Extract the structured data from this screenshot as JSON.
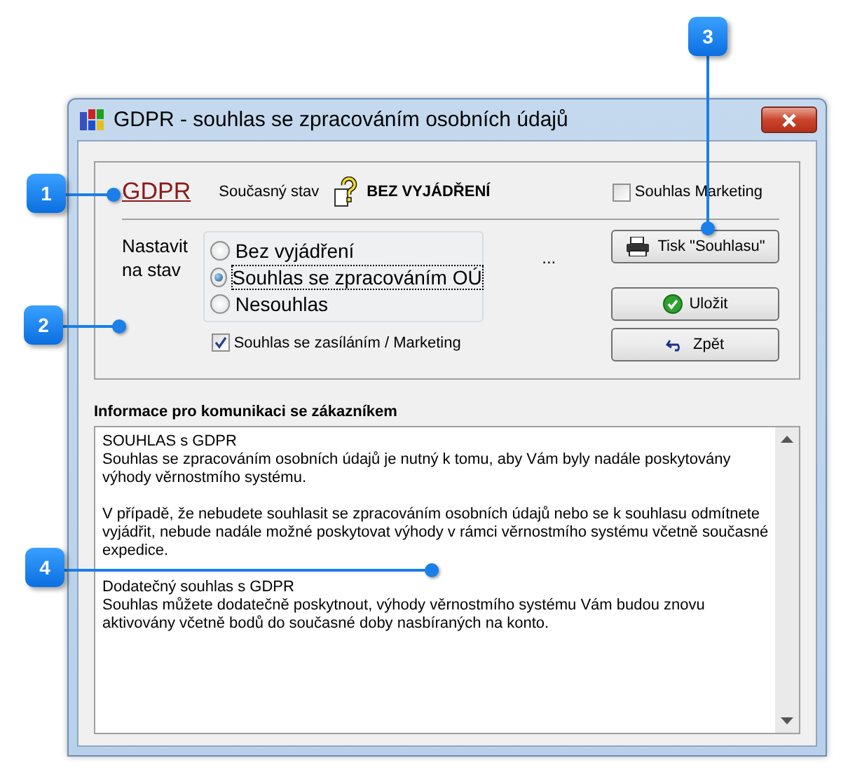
{
  "window": {
    "title": "GDPR - souhlas se zpracováním osobních údajů"
  },
  "header": {
    "link": "GDPR",
    "status_label": "Současný stav",
    "status_value": "BEZ VYJÁDŘENÍ",
    "marketing": {
      "label": "Souhlas Marketing",
      "checked": false
    }
  },
  "set_state": {
    "label": "Nastavit na stav",
    "options": [
      {
        "label": "Bez vyjádření",
        "selected": false
      },
      {
        "label": "Souhlas se zpracováním OÚ",
        "selected": true
      },
      {
        "label": "Nesouhlas",
        "selected": false
      }
    ],
    "mailing": {
      "label": "Souhlas se zasíláním  / Marketing",
      "checked": true
    },
    "ellipsis": "..."
  },
  "buttons": [
    {
      "kind": "print",
      "label": "Tisk \"Souhlasu\""
    },
    {
      "kind": "save",
      "label": "Uložit"
    },
    {
      "kind": "back",
      "label": "Zpět"
    }
  ],
  "info": {
    "label": "Informace pro komunikaci se zákazníkem",
    "blocks": [
      {
        "heading": "SOUHLAS s GDPR",
        "text": "Souhlas se zpracováním osobních údajů je nutný k tomu, aby Vám byly nadále poskytovány výhody věrnostmího systému."
      },
      {
        "text": "V případě, že nebudete souhlasit se zpracováním osobních údajů nebo se k souhlasu odmítnete vyjádřit, nebude nadále možné poskytovat výhody v rámci  věrnostmího systému včetně současné expedice."
      },
      {
        "heading": "Dodatečný souhlas s GDPR",
        "text": "Souhlas můžete dodatečně poskytnout, výhody věrnostmího systému Vám budou znovu aktivovány včetně bodů do současné doby nasbíraných na konto."
      }
    ]
  },
  "callouts": [
    "1",
    "2",
    "3",
    "4"
  ]
}
